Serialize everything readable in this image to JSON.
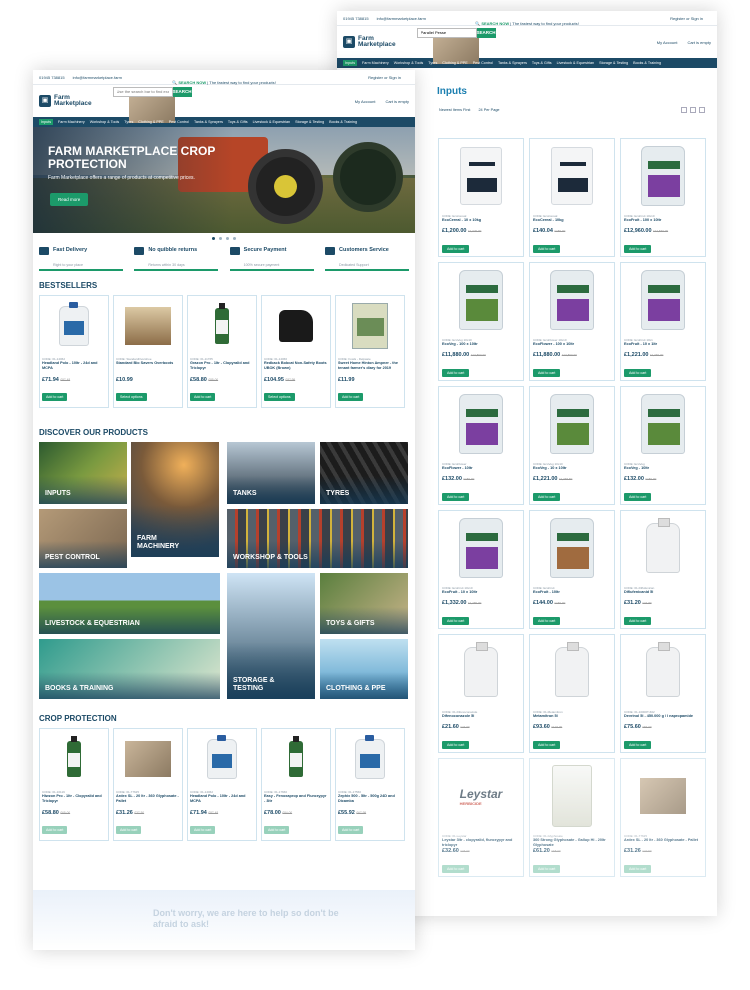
{
  "topbar": {
    "phone": "01945 738815",
    "email": "info@farmmarketplace.farm",
    "register": "Register or Sign in"
  },
  "logo": {
    "line1": "Farm",
    "line2": "Marketplace"
  },
  "search": {
    "tag_strong": "SEARCH NOW",
    "tag_rest": "| The fastest way to find your products!",
    "placeholder": "Use the search bar to find exactly what you need...",
    "back_value": "Parallel Pesse",
    "button": "SEARCH"
  },
  "account": {
    "my_account": "My Account",
    "cart": "Cart is empty"
  },
  "nav": [
    "Inputs",
    "Farm Machinery",
    "Workshop & Tools",
    "Tyres",
    "Clothing & PPE",
    "Pest Control",
    "Tanks & Sprayers",
    "Toys & Gifts",
    "Livestock & Equestrian",
    "Storage & Testing",
    "Books & Training"
  ],
  "hero": {
    "title": "FARM MARKETPLACE CROP PROTECTION",
    "text": "Farm Marketplace offers a range of products at competitive prices.",
    "cta": "Read more"
  },
  "usp": [
    {
      "title": "Fast Delivery",
      "sub": "Right to your place"
    },
    {
      "title": "No quibble returns",
      "sub": "Returns within 30 days"
    },
    {
      "title": "Secure Payment",
      "sub": "100% secure payment"
    },
    {
      "title": "Customers Service",
      "sub": "Dedicated Support"
    }
  ],
  "bestsellers": {
    "title": "BESTSELLERS",
    "items": [
      {
        "code": "CODE: 01-14062",
        "name": "Headland Polo - 10ltr - 24d and MCPA",
        "price": "£71.94",
        "old": "£87.48",
        "btn": "Add to cart"
      },
      {
        "code": "CODE: StandardOvershoe",
        "name": "Standard Bio Savers Overboots",
        "price": "£10.99",
        "old": "",
        "btn": "Select options"
      },
      {
        "code": "CODE: 01-11765",
        "name": "Grazon Pro - 1ltr - Clopyralid and Triclopyr",
        "price": "£58.80",
        "old": "£85.00",
        "btn": "Add to cart"
      },
      {
        "code": "CODE: 01-14066",
        "name": "Redback Bobcat Non-Safety Boots UBOK (Brown)",
        "price": "£104.95",
        "old": "£87.99",
        "btn": "Select options"
      },
      {
        "code": "CODE: Fowls - Delpaste",
        "name": "Sweet Home Hinton Ampner - the tenant farmer's diary for 2019",
        "price": "£11.99",
        "old": "",
        "btn": "Add to cart"
      }
    ]
  },
  "discover": {
    "title": "DISCOVER OUR PRODUCTS",
    "tiles": [
      "INPUTS",
      "FARM MACHINERY",
      "TANKS",
      "TYRES",
      "PEST CONTROL",
      "WORKSHOP & TOOLS",
      "LIVESTOCK & EQUESTRIAN",
      "STORAGE & TESTING",
      "TOYS & GIFTS",
      "BOOKS & TRAINING",
      "CLOTHING & PPE"
    ]
  },
  "crop": {
    "title": "CROP PROTECTION",
    "items": [
      {
        "code": "CODE: 01-10119",
        "name": "Hiwzon Pro - 1ltr - Clopyralid and Triclopyr",
        "price": "£58.80",
        "old": "£65.00",
        "btn": "Add to cart"
      },
      {
        "code": "CODE: 01-77625",
        "name": "Ardex SL - 20 ltr - 360 Glyphosate - Pallet",
        "price": "£31.26",
        "old": "£37.50",
        "btn": "Add to cart"
      },
      {
        "code": "CODE: 01-14062",
        "name": "Headland Polo - 10ltr - 24d and MCPA",
        "price": "£71.94",
        "old": "£87.48",
        "btn": "Add to cart"
      },
      {
        "code": "CODE: 01-17660",
        "name": "Easy - Fenoxaprop and Fluroxypyr - 3ltr",
        "price": "£78.00",
        "old": "£84.00",
        "btn": "Add to cart"
      },
      {
        "code": "CODE: 01-17560",
        "name": "Zephix 500 - 5ltr - 500g 24D and Dicamba",
        "price": "£55.92",
        "old": "£67.99",
        "btn": "Add to cart"
      }
    ]
  },
  "help": {
    "text": "Don't worry, we are here to help so don't be afraid to ask!"
  },
  "inputs_page": {
    "title": "Inputs",
    "sort": "Newest Items First",
    "per_page": "24 Per Page",
    "items": [
      {
        "code": "CODE: EcoCereal",
        "name": "EcoCereal - 10 x 10kg",
        "price": "£1,200.00",
        "old": "£1,320.00",
        "btn": "Add to cart",
        "img": "bag"
      },
      {
        "code": "CODE: EcoCereal",
        "name": "EcoCereal - 10kg",
        "price": "£140.04",
        "old": "£156.00",
        "btn": "Add to cart",
        "img": "bag"
      },
      {
        "code": "CODE: EcoFruit 10x10",
        "name": "EcoFruit - 100 x 10ltr",
        "price": "£12,960.00",
        "old": "£14,560.00",
        "btn": "Add to cart",
        "img": "eco"
      },
      {
        "code": "CODE: EcoVeg 10x10",
        "name": "EcoVeg - 100 x 10ltr",
        "price": "£11,880.00",
        "old": "£13,860.00",
        "btn": "Add to cart",
        "img": "eco g"
      },
      {
        "code": "CODE: EcoFlower 10x10",
        "name": "EcoFlower - 100 x 10ltr",
        "price": "£11,880.00",
        "old": "£13,860.00",
        "btn": "Add to cart",
        "img": "eco"
      },
      {
        "code": "CODE: EcoFruit 10x1",
        "name": "EcoFruit - 10 x 1ltr",
        "price": "£1,221.00",
        "old": "£1,360.00",
        "btn": "Add to cart",
        "img": "eco"
      },
      {
        "code": "CODE: EcoFlower",
        "name": "EcoFlower - 10ltr",
        "price": "£132.00",
        "old": "£150.00",
        "btn": "Add to cart",
        "img": "eco"
      },
      {
        "code": "CODE: EcoVeg 10x10",
        "name": "EcoVeg - 10 x 10ltr",
        "price": "£1,221.00",
        "old": "£1,387.50",
        "btn": "Add to cart",
        "img": "eco g"
      },
      {
        "code": "CODE: EcoVeg",
        "name": "EcoVeg - 10ltr",
        "price": "£132.00",
        "old": "£150.00",
        "btn": "Add to cart",
        "img": "eco g"
      },
      {
        "code": "CODE: EcoFruit 10x10",
        "name": "EcoFruit - 10 x 10ltr",
        "price": "£1,332.00",
        "old": "£1,480.00",
        "btn": "Add to cart",
        "img": "eco"
      },
      {
        "code": "CODE: EcoFruit",
        "name": "EcoFruit - 10ltr",
        "price": "£144.00",
        "old": "£160.00",
        "btn": "Add to cart",
        "img": "eco o"
      },
      {
        "code": "CODE: 01-Diflufenican",
        "name": "Diflufenicanid 5l",
        "price": "£31.20",
        "old": "£34.80",
        "btn": "Add to cart",
        "img": "wjug"
      },
      {
        "code": "CODE: 01-Difenoconazole",
        "name": "Difenoconazole 5l",
        "price": "£21.60",
        "old": "£24.00",
        "btn": "Add to cart",
        "img": "wjug"
      },
      {
        "code": "CODE: 01-Metamitron",
        "name": "Metamitron 5l",
        "price": "£93.60",
        "old": "£104.00",
        "btn": "Add to cart",
        "img": "wjug"
      },
      {
        "code": "CODE: 01-10000T-602",
        "name": "Devrinol 5l - 450.000 g / l napropamide",
        "price": "£75.60",
        "old": "£84.00",
        "btn": "Add to cart",
        "img": "wjug"
      },
      {
        "code": "CODE: 01-Leystar",
        "name": "Leystar 3ltr - clopyralid, fluroxypyr and triclopyr",
        "price": "£32.60",
        "old": "£36.00",
        "btn": "Add to cart",
        "img": "leystar"
      },
      {
        "code": "CODE: 01-Glyphosate",
        "name": "360 Strong Glyphosate - Gallup Hi - 20ltr Glyphosate",
        "price": "£61.20",
        "old": "£68.00",
        "btn": "Add to cart",
        "img": "tank"
      },
      {
        "code": "CODE: 01-77625",
        "name": "Ardex SL - 20 ltr - 360 Glyphosate - Pallet",
        "price": "£31.26",
        "old": "£37.50",
        "btn": "Add to cart",
        "img": "box"
      }
    ]
  },
  "leystar_label": "Leystar",
  "leystar_sub": "HERBICIDE"
}
